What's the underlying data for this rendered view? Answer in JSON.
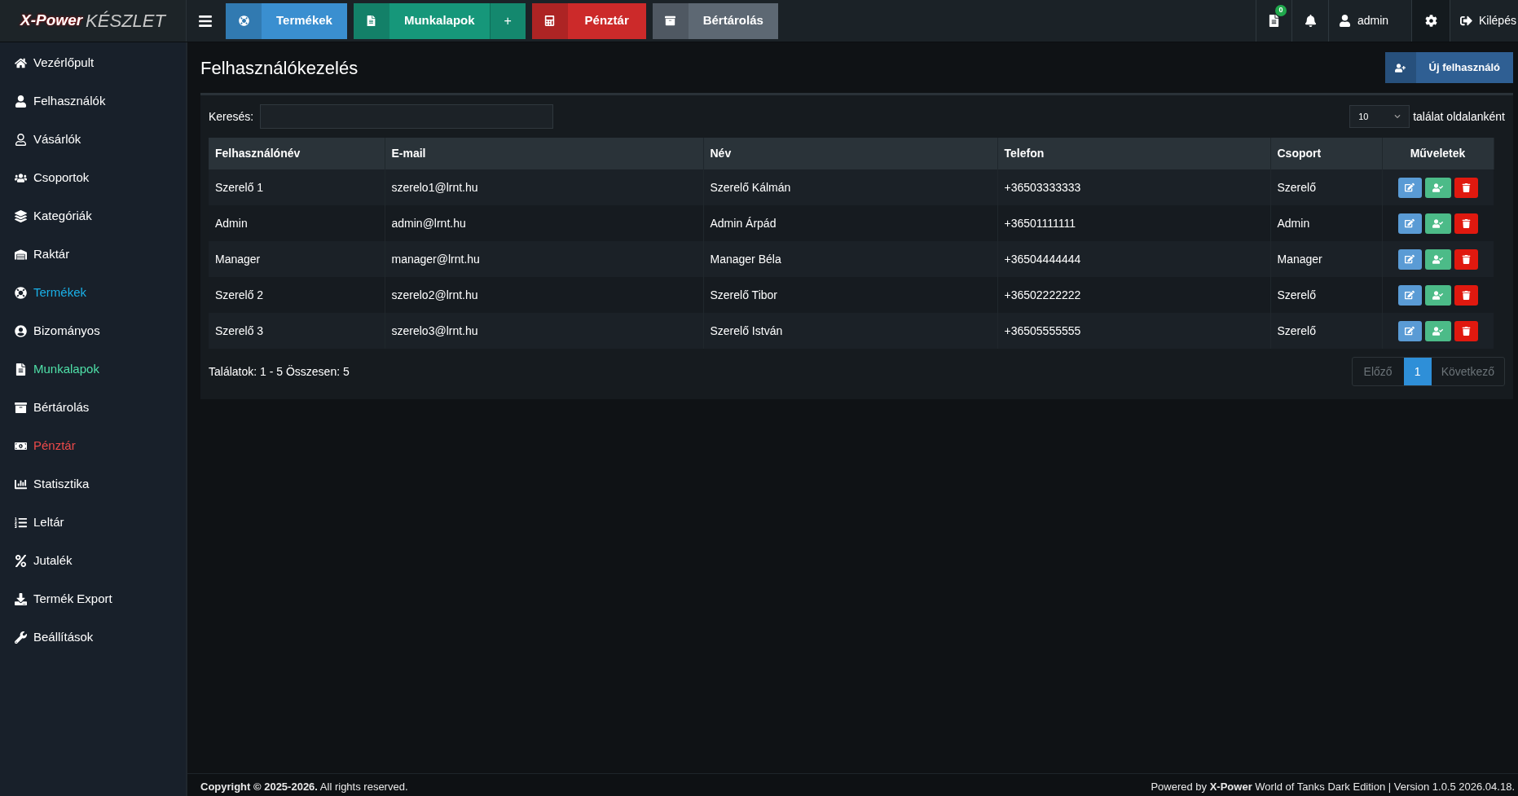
{
  "logo": {
    "brand": "X-Power",
    "product": "KÉSZLET"
  },
  "quick_buttons": [
    {
      "label": "Termékek",
      "color": "#3a8fd0",
      "plus": false
    },
    {
      "label": "Munkalapok",
      "color": "#16977a",
      "plus": true,
      "plus_label": "+"
    },
    {
      "label": "Pénztár",
      "color": "#cc2a2a",
      "plus": false
    },
    {
      "label": "Bértárolás",
      "color": "#5d6873",
      "plus": false
    }
  ],
  "top_right": {
    "badge": "0",
    "user": "admin",
    "logout": "Kilépés"
  },
  "sidebar": {
    "items": [
      {
        "label": "Vezérlőpult"
      },
      {
        "label": "Felhasználók"
      },
      {
        "label": "Vásárlók"
      },
      {
        "label": "Csoportok"
      },
      {
        "label": "Kategóriák"
      },
      {
        "label": "Raktár"
      },
      {
        "label": "Termékek",
        "color": "#1ab0e8"
      },
      {
        "label": "Bizományos"
      },
      {
        "label": "Munkalapok",
        "color": "#4fe0a8"
      },
      {
        "label": "Bértárolás"
      },
      {
        "label": "Pénztár",
        "color": "#ee4a4a"
      },
      {
        "label": "Statisztika"
      },
      {
        "label": "Leltár"
      },
      {
        "label": "Jutalék"
      },
      {
        "label": "Termék Export"
      },
      {
        "label": "Beállítások"
      }
    ]
  },
  "page_title": "Felhasználókezelés",
  "new_button": "Új felhasználó",
  "search": {
    "label": "Keresés:"
  },
  "page_size": {
    "value": "10",
    "suffix": "találat oldalanként"
  },
  "table": {
    "columns": [
      "Felhasználónév",
      "E-mail",
      "Név",
      "Telefon",
      "Csoport",
      "Műveletek"
    ],
    "rows": [
      [
        "Szerelő 1",
        "szerelo1@lrnt.hu",
        "Szerelő Kálmán",
        "+36503333333",
        "Szerelő"
      ],
      [
        "Admin",
        "admin@lrnt.hu",
        "Admin Árpád",
        "+36501111111",
        "Admin"
      ],
      [
        "Manager",
        "manager@lrnt.hu",
        "Manager Béla",
        "+36504444444",
        "Manager"
      ],
      [
        "Szerelő 2",
        "szerelo2@lrnt.hu",
        "Szerelő Tibor",
        "+36502222222",
        "Szerelő"
      ],
      [
        "Szerelő 3",
        "szerelo3@lrnt.hu",
        "Szerelő István",
        "+36505555555",
        "Szerelő"
      ]
    ]
  },
  "summary": "Találatok: 1 - 5 Összesen: 5",
  "pagination": {
    "prev": {
      "label": "Előző",
      "disabled": true
    },
    "pages": [
      {
        "label": "1",
        "selected": true
      }
    ],
    "next": {
      "label": "Következő",
      "disabled": true
    }
  },
  "footer": {
    "left": "**Copyright © 2025-2026.** All rights reserved.",
    "right": "Powered by **X-Power** World of Tanks Dark Edition | Version 1.0.5 2026.04.18."
  }
}
